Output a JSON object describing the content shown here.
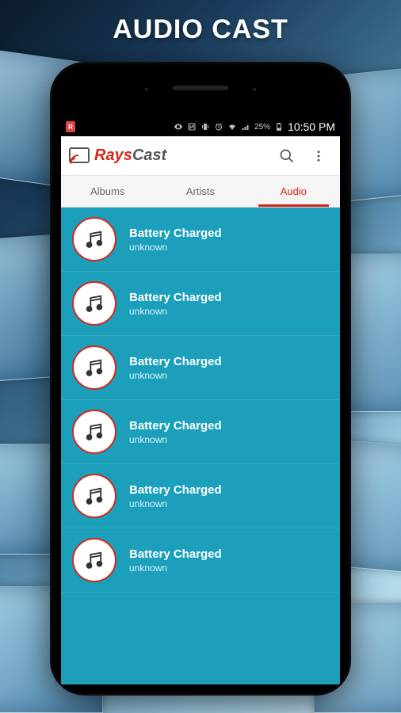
{
  "hero_title": "AUDIO CAST",
  "statusbar": {
    "sim_label": "R",
    "battery_percent": "25%",
    "time": "10:50 PM"
  },
  "app": {
    "name_red": "Rays",
    "name_gray": "Cast"
  },
  "tabs": [
    {
      "label": "Albums",
      "active": false
    },
    {
      "label": "Artists",
      "active": false
    },
    {
      "label": "Audio",
      "active": true
    }
  ],
  "audio_items": [
    {
      "title": "Battery Charged",
      "subtitle": "unknown"
    },
    {
      "title": "Battery Charged",
      "subtitle": "unknown"
    },
    {
      "title": "Battery Charged",
      "subtitle": "unknown"
    },
    {
      "title": "Battery Charged",
      "subtitle": "unknown"
    },
    {
      "title": "Battery Charged",
      "subtitle": "unknown"
    },
    {
      "title": "Battery Charged",
      "subtitle": "unknown"
    }
  ]
}
